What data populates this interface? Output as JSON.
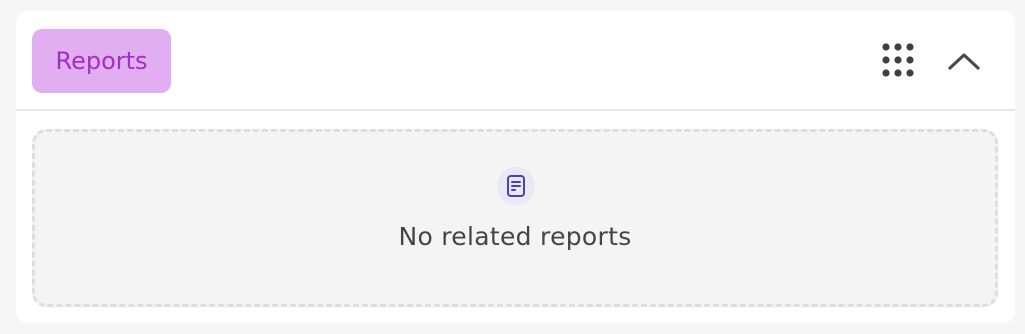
{
  "panel": {
    "badge_label": "Reports",
    "icons": {
      "grid": "grid-dots-icon",
      "collapse": "chevron-up-icon",
      "empty_state": "report-document-icon"
    },
    "empty_state": {
      "message": "No related reports"
    }
  },
  "colors": {
    "badge_bg": "#e1aef2",
    "badge_text": "#a32fc2",
    "icon_accent": "#4a3fc0"
  }
}
